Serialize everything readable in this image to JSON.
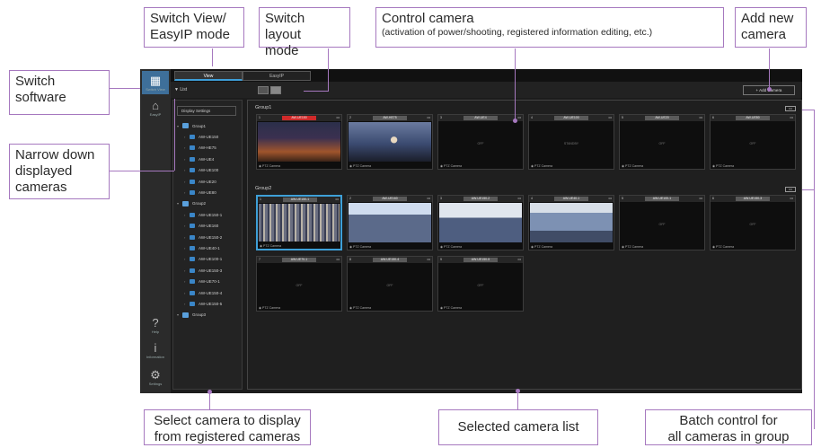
{
  "callouts": {
    "switch_view": "Switch View/\nEasyIP mode",
    "switch_layout": "Switch layout\nmode",
    "control_camera_title": "Control camera",
    "control_camera_note": "(activation of power/shooting, registered information editing, etc.)",
    "add_camera": "Add new\ncamera",
    "switch_software": "Switch\nsoftware",
    "narrow_down": "Narrow down\ndisplayed\ncameras",
    "select_camera": "Select camera to display\nfrom registered cameras",
    "selected_list": "Selected camera list",
    "batch_control": "Batch control for\nall cameras in group"
  },
  "app": {
    "rail": [
      {
        "label": "Switch View",
        "icon": "monitor-icon",
        "glyph": "▦"
      },
      {
        "label": "EasyIP",
        "icon": "camera-box-icon",
        "glyph": "⌂"
      },
      {
        "label": "Help",
        "icon": "help-icon",
        "glyph": "?"
      },
      {
        "label": "Information",
        "icon": "info-icon",
        "glyph": "i"
      },
      {
        "label": "Settings",
        "icon": "gear-icon",
        "glyph": "⚙"
      }
    ],
    "mode_tabs": [
      "View",
      "EasyIP"
    ],
    "filter_label": "▼ List",
    "add_camera_label": "+ Add Camera",
    "display_button": "Display Settings",
    "tree": [
      {
        "label": "Group1",
        "group": true
      },
      {
        "label": "AW-UE150",
        "group": false
      },
      {
        "label": "AW-HE75",
        "group": false
      },
      {
        "label": "AW-UE4",
        "group": false
      },
      {
        "label": "AW-UE100",
        "group": false
      },
      {
        "label": "AW-UE20",
        "group": false
      },
      {
        "label": "AW-UE80",
        "group": false
      },
      {
        "label": "Group2",
        "group": true
      },
      {
        "label": "AW-UE150-1",
        "group": false
      },
      {
        "label": "AW-UE160",
        "group": false
      },
      {
        "label": "AW-UE150-2",
        "group": false
      },
      {
        "label": "AW-UE40-1",
        "group": false
      },
      {
        "label": "AW-UE100-1",
        "group": false
      },
      {
        "label": "AW-UE150-3",
        "group": false
      },
      {
        "label": "AW-UE70-1",
        "group": false
      },
      {
        "label": "AW-UE150-4",
        "group": false
      },
      {
        "label": "AW-UE150-5",
        "group": false
      },
      {
        "label": "Group3",
        "group": true
      }
    ],
    "groups": [
      {
        "label": "Group1",
        "batch": "•••",
        "tiles": [
          {
            "num": "1",
            "name": "AW-UE150",
            "rec": true,
            "image": "img-stage",
            "foot": "PTZ Camera",
            "off": ""
          },
          {
            "num": "2",
            "name": "AW-HE75",
            "rec": false,
            "image": "img-speaker",
            "foot": "PTZ Camera",
            "off": ""
          },
          {
            "num": "3",
            "name": "AW-UE4",
            "rec": false,
            "image": "",
            "foot": "PTZ Camera",
            "off": "OFF"
          },
          {
            "num": "4",
            "name": "AW-UE100",
            "rec": false,
            "image": "",
            "foot": "PTZ Camera",
            "off": "STANDBY"
          },
          {
            "num": "5",
            "name": "AW-UE20",
            "rec": false,
            "image": "",
            "foot": "PTZ Camera",
            "off": "OFF"
          },
          {
            "num": "6",
            "name": "AW-UE80",
            "rec": false,
            "image": "",
            "foot": "PTZ Camera",
            "off": "OFF"
          }
        ]
      },
      {
        "label": "Group2",
        "batch": "•••",
        "tiles": [
          {
            "num": "1",
            "name": "AW-UE150-1",
            "rec": false,
            "image": "img-crowd",
            "foot": "PTZ Camera",
            "off": "",
            "selected": true
          },
          {
            "num": "2",
            "name": "AW-UE160",
            "rec": false,
            "image": "img-crowd2",
            "foot": "PTZ Camera",
            "off": ""
          },
          {
            "num": "3",
            "name": "AW-UE150-2",
            "rec": false,
            "image": "img-crowd3",
            "foot": "PTZ Camera",
            "off": ""
          },
          {
            "num": "4",
            "name": "AW-UE40-1",
            "rec": false,
            "image": "img-screen",
            "foot": "PTZ Camera",
            "off": ""
          },
          {
            "num": "5",
            "name": "AW-UE100-1",
            "rec": false,
            "image": "",
            "foot": "PTZ Camera",
            "off": "OFF"
          },
          {
            "num": "6",
            "name": "AW-UE150-3",
            "rec": false,
            "image": "",
            "foot": "PTZ Camera",
            "off": "OFF"
          },
          {
            "num": "7",
            "name": "AW-UE70-1",
            "rec": false,
            "image": "",
            "foot": "PTZ Camera",
            "off": "OFF"
          },
          {
            "num": "8",
            "name": "AW-UE150-4",
            "rec": false,
            "image": "",
            "foot": "PTZ Camera",
            "off": "OFF"
          },
          {
            "num": "9",
            "name": "AW-UE150-5",
            "rec": false,
            "image": "",
            "foot": "PTZ Camera",
            "off": "OFF"
          }
        ]
      }
    ],
    "colors": {
      "accent": "#3ea0d8",
      "rec": "#d02a2a",
      "annotation": "#a678bf"
    }
  }
}
